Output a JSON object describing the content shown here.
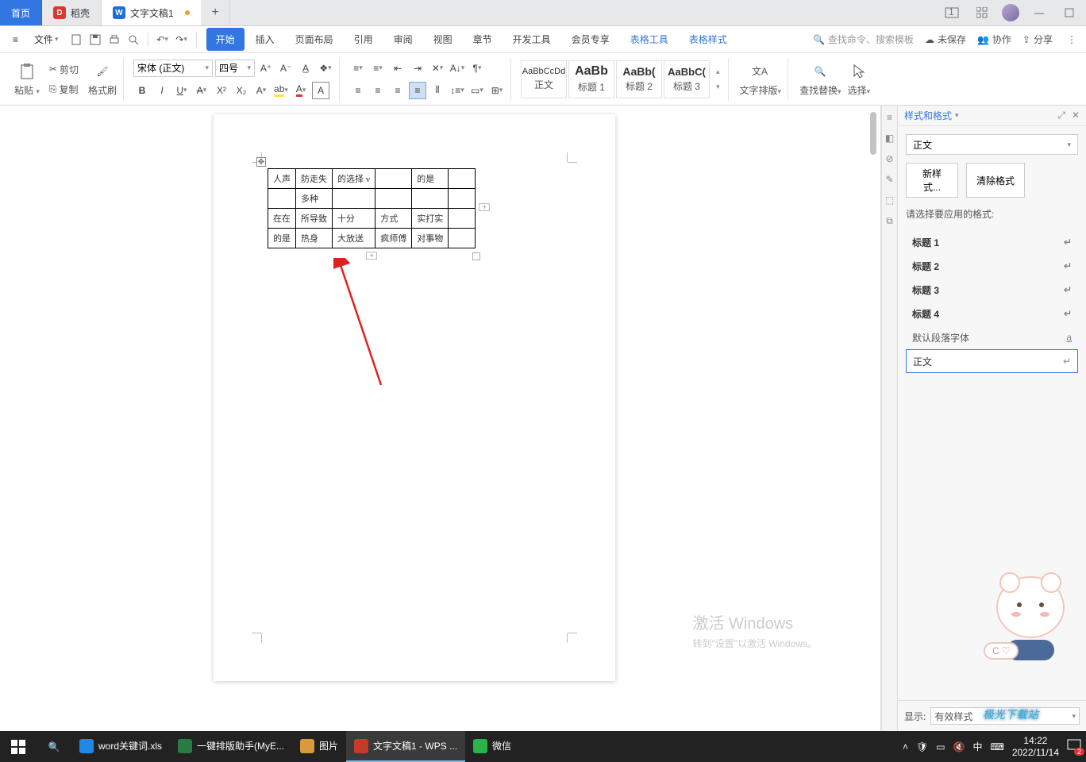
{
  "titlebar": {
    "home": "首页",
    "docs": "稻壳",
    "doc_name": "文字文稿1",
    "docs_icon": "W",
    "badge": "1"
  },
  "menubar": {
    "file": "文件",
    "items": [
      "开始",
      "插入",
      "页面布局",
      "引用",
      "审阅",
      "视图",
      "章节",
      "开发工具",
      "会员专享",
      "表格工具",
      "表格样式"
    ],
    "search_placeholder": "查找命令、搜索模板",
    "unsaved": "未保存",
    "coop": "协作",
    "share": "分享"
  },
  "ribbon": {
    "paste": "粘贴",
    "cut": "剪切",
    "copy": "复制",
    "fmt_painter": "格式刷",
    "font_name": "宋体 (正文)",
    "font_size": "四号",
    "styles": [
      {
        "preview": "AaBbCcDd",
        "label": "正文"
      },
      {
        "preview": "AaBb",
        "label": "标题 1"
      },
      {
        "preview": "AaBb(",
        "label": "标题 2"
      },
      {
        "preview": "AaBbC(",
        "label": "标题 3"
      }
    ],
    "typeset": "文字排版",
    "find_replace": "查找替换",
    "select": "选择"
  },
  "table": {
    "rows": [
      [
        "人声",
        "防走失",
        "的选择 v",
        "",
        "的是",
        ""
      ],
      [
        "",
        "多种",
        "",
        "",
        "",
        ""
      ],
      [
        "在在",
        "所导致",
        "十分",
        "方式",
        "实打实",
        ""
      ],
      [
        "的是",
        "热身",
        "大放送",
        "疯师傅",
        "对事物",
        ""
      ]
    ]
  },
  "panel": {
    "title": "样式和格式",
    "current": "正文",
    "new_style": "新样式...",
    "clear_fmt": "清除格式",
    "choose_label": "请选择要应用的格式:",
    "list": [
      "标题 1",
      "标题 2",
      "标题 3",
      "标题 4"
    ],
    "default_font": "默认段落字体",
    "body": "正文",
    "show_label": "显示:",
    "show_value": "有效样式"
  },
  "watermark": {
    "line1": "激活 Windows",
    "line2": "转到\"设置\"以激活 Windows。"
  },
  "taskbar": {
    "items": [
      {
        "label": "word关键词.xls",
        "color": "#1e88e5"
      },
      {
        "label": "一键排版助手(MyE...",
        "color": "#2a7a44"
      },
      {
        "label": "图片",
        "color": "#d89a3a"
      },
      {
        "label": "文字文稿1 - WPS ...",
        "color": "#c73a2a"
      },
      {
        "label": "微信",
        "color": "#2bb24a"
      }
    ],
    "ime": "中",
    "time": "14:22",
    "date": "2022/11/14",
    "notif": "2"
  },
  "watermark_logo": "极光下载站"
}
